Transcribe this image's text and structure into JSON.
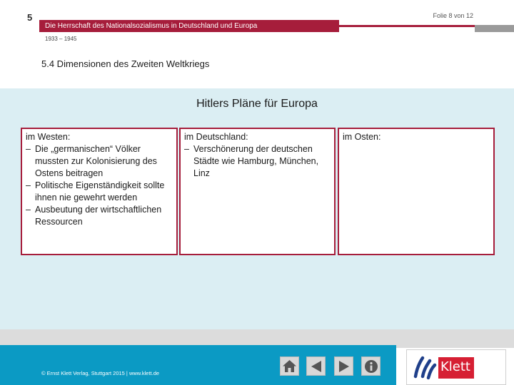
{
  "header": {
    "chapter": "5",
    "slide_counter": "Folie 8 von 12",
    "title": "Die Herrschaft des Nationalsozialismus in Deutschland und Europa",
    "period": "1933 – 1945",
    "section": "5.4 Dimensionen des Zweiten Weltkriegs"
  },
  "main": {
    "heading": "Hitlers Pläne für Europa",
    "boxes": [
      {
        "title": "im Westen:",
        "items": [
          "Die „germanischen“ Völker mussten zur Kolonisierung des Ostens beitragen",
          "Politische Eigenständigkeit sollte ihnen nie gewehrt werden",
          "Ausbeutung der wirtschaftlichen Ressourcen"
        ]
      },
      {
        "title": "im Deutschland:",
        "items": [
          "Verschönerung der deutschen Städte wie Hamburg, München, Linz"
        ]
      },
      {
        "title": "im Osten:",
        "items": []
      }
    ]
  },
  "footer": {
    "copyright": "© Ernst Klett Verlag, Stuttgart 2015 | www.klett.de",
    "nav_icons": [
      "home-icon",
      "previous-icon",
      "next-icon",
      "info-icon"
    ],
    "logo_text": "Klett"
  },
  "colors": {
    "accent": "#a61d3b",
    "content_bg": "#dbeef3",
    "footer_band": "#0b9ac4",
    "logo_red": "#d61f33"
  }
}
